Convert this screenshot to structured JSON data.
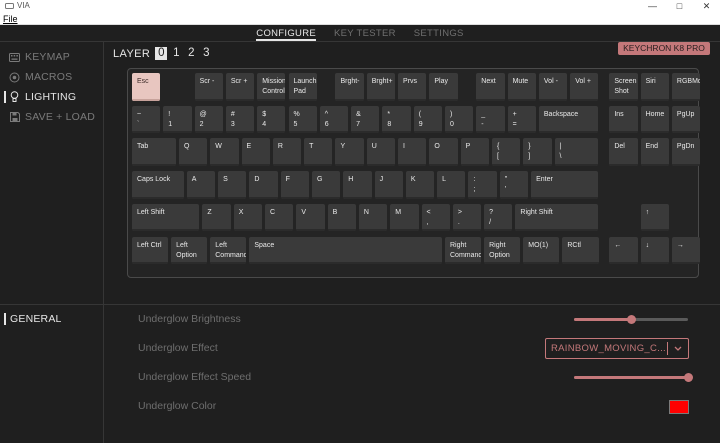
{
  "titlebar": {
    "app_name": "VIA",
    "min": "—",
    "max": "□",
    "close": "✕"
  },
  "menubar": {
    "file": "File"
  },
  "tabs": [
    {
      "label": "CONFIGURE",
      "active": true
    },
    {
      "label": "KEY TESTER",
      "active": false
    },
    {
      "label": "SETTINGS",
      "active": false
    }
  ],
  "sidebar": {
    "items": [
      {
        "label": "KEYMAP",
        "icon": "keyboard-icon",
        "active": false
      },
      {
        "label": "MACROS",
        "icon": "macro-circle-icon",
        "active": false
      },
      {
        "label": "LIGHTING",
        "icon": "lightbulb-icon",
        "active": true
      },
      {
        "label": "SAVE + LOAD",
        "icon": "floppy-disk-icon",
        "active": false
      }
    ]
  },
  "layer": {
    "label": "LAYER",
    "layers": [
      "0",
      "1",
      "2",
      "3"
    ],
    "selected": 0
  },
  "brand_badge": "KEYCHRON K8 PRO",
  "keyboard": {
    "rows": [
      [
        [
          "Esc",
          ""
        ],
        [
          "Scr -",
          ""
        ],
        [
          "Scr +",
          ""
        ],
        [
          "Mission",
          "Control"
        ],
        [
          "Launch",
          "Pad"
        ],
        [
          "Brght-",
          ""
        ],
        [
          "Brght+",
          ""
        ],
        [
          "Prvs",
          ""
        ],
        [
          "Play",
          ""
        ],
        [
          "Next",
          ""
        ],
        [
          "Mute",
          ""
        ],
        [
          "Vol -",
          ""
        ],
        [
          "Vol +",
          ""
        ],
        [
          "Screen",
          "Shot"
        ],
        [
          "Siri",
          ""
        ],
        [
          "RGBMd+",
          ""
        ]
      ],
      [
        [
          "~",
          "`"
        ],
        [
          "!",
          "1"
        ],
        [
          "@",
          "2"
        ],
        [
          "#",
          "3"
        ],
        [
          "$",
          "4"
        ],
        [
          "%",
          "5"
        ],
        [
          "^",
          "6"
        ],
        [
          "&",
          "7"
        ],
        [
          "*",
          "8"
        ],
        [
          "(",
          "9"
        ],
        [
          ")",
          "0"
        ],
        [
          "_",
          "-"
        ],
        [
          "+",
          "="
        ],
        [
          "Backspace",
          ""
        ],
        [
          "Ins",
          ""
        ],
        [
          "Home",
          ""
        ],
        [
          "PgUp",
          ""
        ]
      ],
      [
        [
          "Tab",
          ""
        ],
        [
          "Q",
          ""
        ],
        [
          "W",
          ""
        ],
        [
          "E",
          ""
        ],
        [
          "R",
          ""
        ],
        [
          "T",
          ""
        ],
        [
          "Y",
          ""
        ],
        [
          "U",
          ""
        ],
        [
          "I",
          ""
        ],
        [
          "O",
          ""
        ],
        [
          "P",
          ""
        ],
        [
          "{",
          "["
        ],
        [
          "}",
          "]"
        ],
        [
          "|",
          "\\"
        ],
        [
          "Del",
          ""
        ],
        [
          "End",
          ""
        ],
        [
          "PgDn",
          ""
        ]
      ],
      [
        [
          "Caps Lock",
          ""
        ],
        [
          "A",
          ""
        ],
        [
          "S",
          ""
        ],
        [
          "D",
          ""
        ],
        [
          "F",
          ""
        ],
        [
          "G",
          ""
        ],
        [
          "H",
          ""
        ],
        [
          "J",
          ""
        ],
        [
          "K",
          ""
        ],
        [
          "L",
          ""
        ],
        [
          ":",
          ";"
        ],
        [
          "\"",
          "'"
        ],
        [
          "Enter",
          ""
        ]
      ],
      [
        [
          "Left Shift",
          ""
        ],
        [
          "Z",
          ""
        ],
        [
          "X",
          ""
        ],
        [
          "C",
          ""
        ],
        [
          "V",
          ""
        ],
        [
          "B",
          ""
        ],
        [
          "N",
          ""
        ],
        [
          "M",
          ""
        ],
        [
          "<",
          ","
        ],
        [
          ">",
          "."
        ],
        [
          "?",
          "/"
        ],
        [
          "Right Shift",
          ""
        ],
        [
          "↑",
          ""
        ]
      ],
      [
        [
          "Left Ctrl",
          ""
        ],
        [
          "Left",
          "Option"
        ],
        [
          "Left",
          "Command"
        ],
        [
          "Space",
          ""
        ],
        [
          "Right",
          "Command"
        ],
        [
          "Right",
          "Option"
        ],
        [
          "MO(1)",
          ""
        ],
        [
          "RCtl",
          ""
        ],
        [
          "←",
          ""
        ],
        [
          "↓",
          ""
        ],
        [
          "→",
          ""
        ]
      ]
    ]
  },
  "lighting": {
    "section": "GENERAL",
    "brightness_label": "Underglow Brightness",
    "brightness_value": 0.5,
    "effect_label": "Underglow Effect",
    "effect_value": "RAINBOW_MOVING_C...",
    "speed_label": "Underglow Effect Speed",
    "speed_value": 1.0,
    "color_label": "Underglow Color",
    "color_value": "#ff0000"
  },
  "colors": {
    "accent": "#c4787a",
    "background": "#1f1f1f",
    "key": "#3a3a3a",
    "esc_key": "#e8c6c0"
  }
}
